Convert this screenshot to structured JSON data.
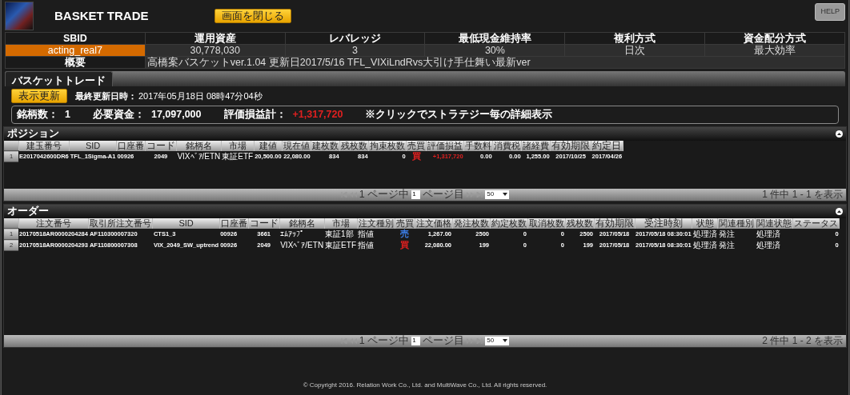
{
  "header": {
    "title": "BASKET TRADE",
    "close_button": "画面を閉じる",
    "help_button": "HELP"
  },
  "info": {
    "columns": [
      "SBID",
      "運用資産",
      "レバレッジ",
      "最低現金維持率",
      "複利方式",
      "資金配分方式"
    ],
    "values": [
      {
        "text": "acting_real7",
        "highlighted": true
      },
      {
        "text": "30,778,030",
        "highlighted": false
      },
      {
        "text": "3",
        "highlighted": false
      },
      {
        "text": "30%",
        "highlighted": false
      },
      {
        "text": "日次",
        "highlighted": false
      },
      {
        "text": "最大効率",
        "highlighted": false
      }
    ],
    "summary_label": "概要",
    "summary_text": "高橋案バスケットver.1.04 更新日2017/5/16 TFL_VIXiLndRvs大引け手仕舞い最新ver"
  },
  "tabs": [
    {
      "label": "バスケットトレード",
      "selected": true
    }
  ],
  "refresh_button": "表示更新",
  "last_updated_label": "最終更新日時：",
  "last_updated": "2017年05月18日 08時47分04秒",
  "stats": [
    {
      "label": "銘柄数：",
      "value": "1",
      "kind": "plain"
    },
    {
      "label": "必要資金：",
      "value": "17,097,000",
      "kind": "plain"
    },
    {
      "label": "評価損益計：",
      "value": "+1,317,720",
      "kind": "profit"
    }
  ],
  "note": "※クリックでストラテジー毎の詳細表示",
  "panels": [
    {
      "title": "ポジション",
      "columns": [
        {
          "label": "建玉番号",
          "kind": "text"
        },
        {
          "label": "SID",
          "kind": "text"
        },
        {
          "label": "口座番",
          "kind": "text"
        },
        {
          "label": "コード",
          "kind": "code"
        },
        {
          "label": "銘柄名",
          "kind": "jp"
        },
        {
          "label": "市場",
          "kind": "jp"
        },
        {
          "label": "建値",
          "kind": "number"
        },
        {
          "label": "現在値",
          "kind": "number"
        },
        {
          "label": "建枚数",
          "kind": "number"
        },
        {
          "label": "残枚数",
          "kind": "number"
        },
        {
          "label": "拘束枚数",
          "kind": "number"
        },
        {
          "label": "売買",
          "kind": "side"
        },
        {
          "label": "評価損益",
          "kind": "pnl"
        },
        {
          "label": "手数料",
          "kind": "number"
        },
        {
          "label": "消費税",
          "kind": "number"
        },
        {
          "label": "諸経費",
          "kind": "number"
        },
        {
          "label": "有効期限",
          "kind": "code"
        },
        {
          "label": "約定日",
          "kind": "code"
        }
      ],
      "rows": [
        {
          "index": "1",
          "buy": true,
          "pnl_positive": true,
          "cells": [
            "E2017042600DR6",
            "TFL_1Sigma-A1",
            "00926",
            "2049",
            "VIXﾍﾞｱ/ETN",
            "東証ETF",
            "20,500.00",
            "22,080.00",
            "834",
            "834",
            "0",
            "買",
            "+1,317,720",
            "0.00",
            "0.00",
            "1,255.00",
            "2017/10/25",
            "2017/04/26"
          ]
        }
      ],
      "pager": {
        "page_of": "1 ページ中",
        "page": "1",
        "page_suffix": "ページ目",
        "page_size": "50",
        "count": "1 件中 1 - 1 を表示"
      }
    },
    {
      "title": "オーダー",
      "columns": [
        {
          "label": "注文番号",
          "kind": "text"
        },
        {
          "label": "取引所注文番号",
          "kind": "text"
        },
        {
          "label": "SID",
          "kind": "text"
        },
        {
          "label": "口座番",
          "kind": "text"
        },
        {
          "label": "コード",
          "kind": "code"
        },
        {
          "label": "銘柄名",
          "kind": "jp"
        },
        {
          "label": "市場",
          "kind": "jp"
        },
        {
          "label": "注文種別",
          "kind": "jp"
        },
        {
          "label": "売買",
          "kind": "side"
        },
        {
          "label": "注文価格",
          "kind": "number"
        },
        {
          "label": "発注枚数",
          "kind": "number"
        },
        {
          "label": "約定枚数",
          "kind": "number"
        },
        {
          "label": "取消枚数",
          "kind": "number"
        },
        {
          "label": "残枚数",
          "kind": "number"
        },
        {
          "label": "有効期限",
          "kind": "code"
        },
        {
          "label": "受注時刻",
          "kind": "code"
        },
        {
          "label": "状態",
          "kind": "jp"
        },
        {
          "label": "関連種別",
          "kind": "jp"
        },
        {
          "label": "関連状態",
          "kind": "jp"
        },
        {
          "label": "ステータス",
          "kind": "number"
        }
      ],
      "rows": [
        {
          "index": "1",
          "buy": false,
          "cells": [
            "20170518AR0000204284",
            "AF110300007320",
            "CTS1_3",
            "00926",
            "3661",
            "ｴﾑｱｯﾌﾟ",
            "東証1部",
            "指値",
            "売",
            "1,267.00",
            "2500",
            "0",
            "0",
            "2500",
            "2017/05/18",
            "2017/05/18 08:30:01",
            "処理済",
            "発注",
            "処理済",
            "0"
          ]
        },
        {
          "index": "2",
          "buy": true,
          "cells": [
            "20170518AR0000204293",
            "AF110800007308",
            "VIX_2049_SW_uptrend",
            "00926",
            "2049",
            "VIXﾍﾞｱ/ETN",
            "東証ETF",
            "指値",
            "買",
            "22,080.00",
            "199",
            "0",
            "0",
            "199",
            "2017/05/18",
            "2017/05/18 08:30:01",
            "処理済",
            "発注",
            "処理済",
            "0"
          ]
        }
      ],
      "pager": {
        "page_of": "1 ページ中",
        "page": "1",
        "page_suffix": "ページ目",
        "page_size": "50",
        "count": "2 件中 1 - 2 を表示"
      }
    }
  ],
  "footer": "© Copyright 2016. Relation Work Co., Ltd. and MultiWave Co., Ltd. All rights reserved."
}
